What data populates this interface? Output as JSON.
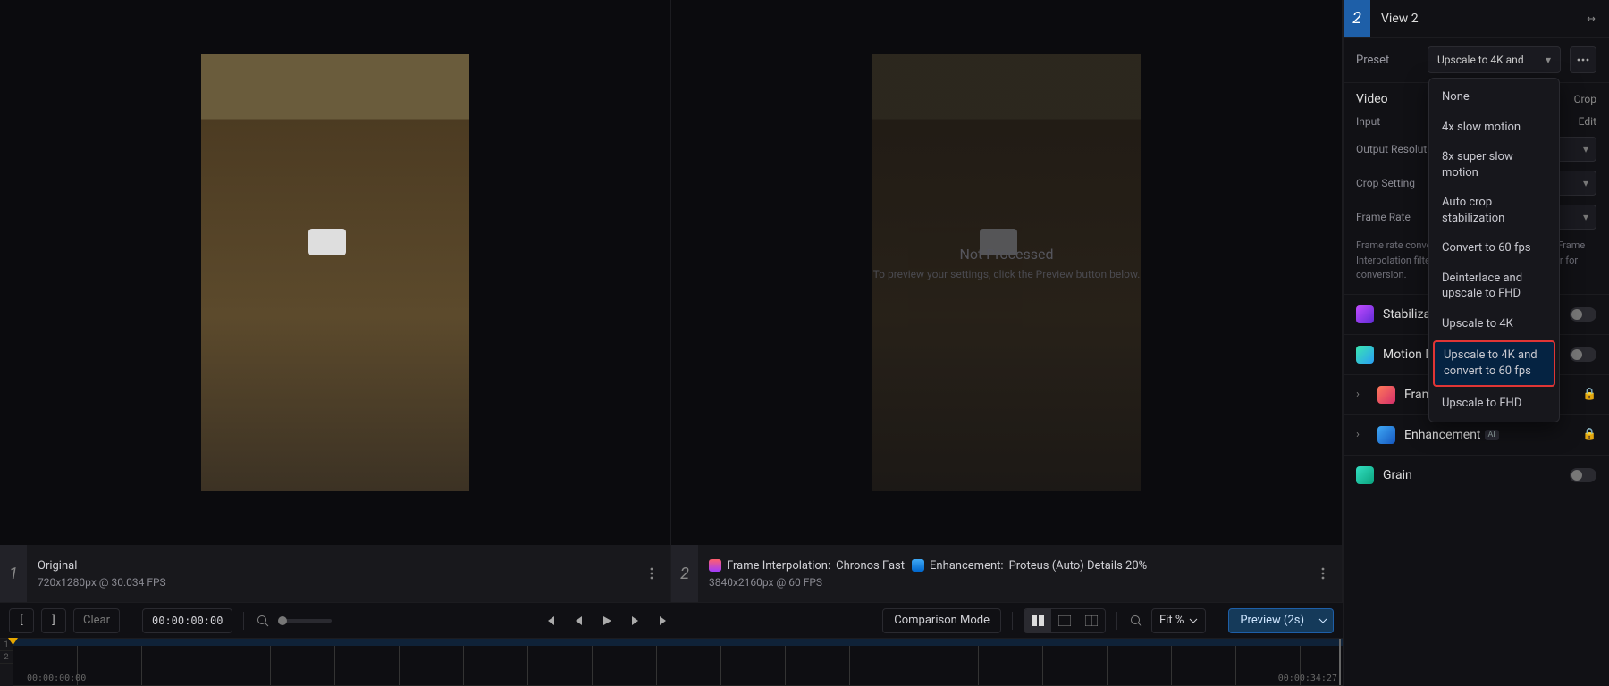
{
  "preview": {
    "left": {
      "index": "1",
      "title": "Original",
      "meta": "720x1280px @ 30.034 FPS"
    },
    "right": {
      "index": "2",
      "not_processed_title": "Not Processed",
      "not_processed_sub": "To preview your settings, click the Preview button below.",
      "chip_interp_label": "Frame Interpolation:",
      "chip_interp_value": "Chronos Fast",
      "chip_enh_label": "Enhancement:",
      "chip_enh_value": "Proteus (Auto) Details 20%",
      "meta": "3840x2160px @ 60 FPS"
    }
  },
  "transport": {
    "mark_in": "[",
    "mark_out": "]",
    "clear": "Clear",
    "timecode": "00:00:00:00",
    "comparison_mode": "Comparison Mode",
    "fit_label": "Fit %",
    "preview_label": "Preview (2s)"
  },
  "timeline": {
    "track1": "1",
    "track2": "2",
    "tc_start": "00:00:00:00",
    "tc_end": "00:00:34:27"
  },
  "side": {
    "view_index": "2",
    "view_title": "View 2",
    "preset_label": "Preset",
    "preset_selected": "Upscale to 4K and ",
    "preset_options": {
      "none": "None",
      "slow4x": "4x slow motion",
      "slow8x": "8x super slow motion",
      "autocrop": "Auto crop stabilization",
      "conv60": "Convert to 60 fps",
      "deint": "Deinterlace and upscale to FHD",
      "up4k": "Upscale to 4K",
      "up4k60": "Upscale to 4K and convert to 60 fps",
      "upfhd": "Upscale to FHD"
    },
    "video_heading": "Video",
    "crop_link": "Crop",
    "edit_link": "Edit",
    "input_label": "Input",
    "output_res_label": "Output Resolution",
    "crop_setting_label": "Crop Setting",
    "frame_rate_label": "Frame Rate",
    "note": "Frame rate conversion has been moved to the Frame Interpolation filter. Please use the Chronos filter for conversion.",
    "features": {
      "stabilization": "Stabilization",
      "motion_deblur": "Motion Deblur",
      "frame_interpolation": "Frame Interpolation",
      "enhancement": "Enhancement",
      "grain": "Grain"
    }
  }
}
